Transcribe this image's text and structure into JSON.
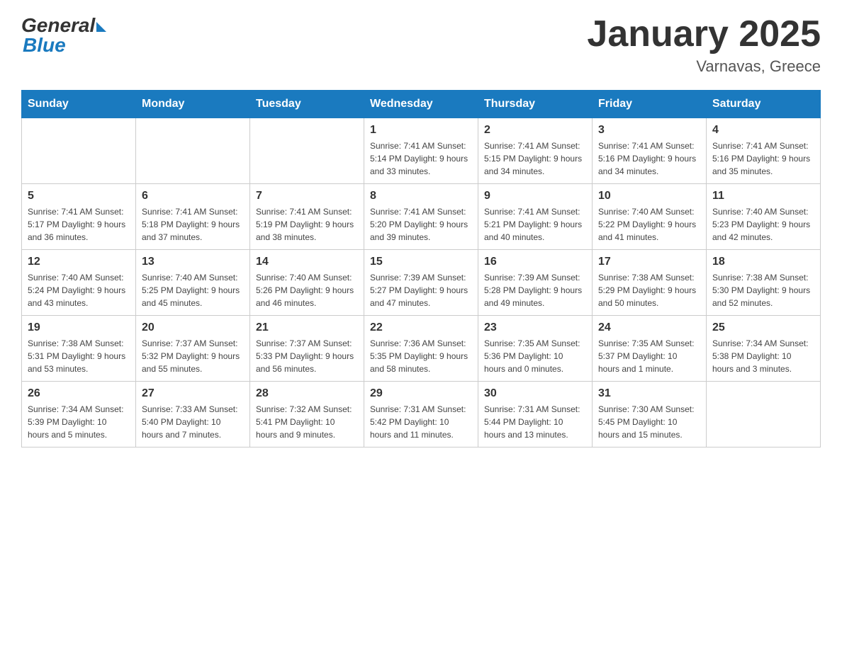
{
  "header": {
    "logo": {
      "general": "General",
      "blue": "Blue"
    },
    "title": "January 2025",
    "subtitle": "Varnavas, Greece"
  },
  "calendar": {
    "weekdays": [
      "Sunday",
      "Monday",
      "Tuesday",
      "Wednesday",
      "Thursday",
      "Friday",
      "Saturday"
    ],
    "weeks": [
      [
        {
          "day": "",
          "info": ""
        },
        {
          "day": "",
          "info": ""
        },
        {
          "day": "",
          "info": ""
        },
        {
          "day": "1",
          "info": "Sunrise: 7:41 AM\nSunset: 5:14 PM\nDaylight: 9 hours\nand 33 minutes."
        },
        {
          "day": "2",
          "info": "Sunrise: 7:41 AM\nSunset: 5:15 PM\nDaylight: 9 hours\nand 34 minutes."
        },
        {
          "day": "3",
          "info": "Sunrise: 7:41 AM\nSunset: 5:16 PM\nDaylight: 9 hours\nand 34 minutes."
        },
        {
          "day": "4",
          "info": "Sunrise: 7:41 AM\nSunset: 5:16 PM\nDaylight: 9 hours\nand 35 minutes."
        }
      ],
      [
        {
          "day": "5",
          "info": "Sunrise: 7:41 AM\nSunset: 5:17 PM\nDaylight: 9 hours\nand 36 minutes."
        },
        {
          "day": "6",
          "info": "Sunrise: 7:41 AM\nSunset: 5:18 PM\nDaylight: 9 hours\nand 37 minutes."
        },
        {
          "day": "7",
          "info": "Sunrise: 7:41 AM\nSunset: 5:19 PM\nDaylight: 9 hours\nand 38 minutes."
        },
        {
          "day": "8",
          "info": "Sunrise: 7:41 AM\nSunset: 5:20 PM\nDaylight: 9 hours\nand 39 minutes."
        },
        {
          "day": "9",
          "info": "Sunrise: 7:41 AM\nSunset: 5:21 PM\nDaylight: 9 hours\nand 40 minutes."
        },
        {
          "day": "10",
          "info": "Sunrise: 7:40 AM\nSunset: 5:22 PM\nDaylight: 9 hours\nand 41 minutes."
        },
        {
          "day": "11",
          "info": "Sunrise: 7:40 AM\nSunset: 5:23 PM\nDaylight: 9 hours\nand 42 minutes."
        }
      ],
      [
        {
          "day": "12",
          "info": "Sunrise: 7:40 AM\nSunset: 5:24 PM\nDaylight: 9 hours\nand 43 minutes."
        },
        {
          "day": "13",
          "info": "Sunrise: 7:40 AM\nSunset: 5:25 PM\nDaylight: 9 hours\nand 45 minutes."
        },
        {
          "day": "14",
          "info": "Sunrise: 7:40 AM\nSunset: 5:26 PM\nDaylight: 9 hours\nand 46 minutes."
        },
        {
          "day": "15",
          "info": "Sunrise: 7:39 AM\nSunset: 5:27 PM\nDaylight: 9 hours\nand 47 minutes."
        },
        {
          "day": "16",
          "info": "Sunrise: 7:39 AM\nSunset: 5:28 PM\nDaylight: 9 hours\nand 49 minutes."
        },
        {
          "day": "17",
          "info": "Sunrise: 7:38 AM\nSunset: 5:29 PM\nDaylight: 9 hours\nand 50 minutes."
        },
        {
          "day": "18",
          "info": "Sunrise: 7:38 AM\nSunset: 5:30 PM\nDaylight: 9 hours\nand 52 minutes."
        }
      ],
      [
        {
          "day": "19",
          "info": "Sunrise: 7:38 AM\nSunset: 5:31 PM\nDaylight: 9 hours\nand 53 minutes."
        },
        {
          "day": "20",
          "info": "Sunrise: 7:37 AM\nSunset: 5:32 PM\nDaylight: 9 hours\nand 55 minutes."
        },
        {
          "day": "21",
          "info": "Sunrise: 7:37 AM\nSunset: 5:33 PM\nDaylight: 9 hours\nand 56 minutes."
        },
        {
          "day": "22",
          "info": "Sunrise: 7:36 AM\nSunset: 5:35 PM\nDaylight: 9 hours\nand 58 minutes."
        },
        {
          "day": "23",
          "info": "Sunrise: 7:35 AM\nSunset: 5:36 PM\nDaylight: 10 hours\nand 0 minutes."
        },
        {
          "day": "24",
          "info": "Sunrise: 7:35 AM\nSunset: 5:37 PM\nDaylight: 10 hours\nand 1 minute."
        },
        {
          "day": "25",
          "info": "Sunrise: 7:34 AM\nSunset: 5:38 PM\nDaylight: 10 hours\nand 3 minutes."
        }
      ],
      [
        {
          "day": "26",
          "info": "Sunrise: 7:34 AM\nSunset: 5:39 PM\nDaylight: 10 hours\nand 5 minutes."
        },
        {
          "day": "27",
          "info": "Sunrise: 7:33 AM\nSunset: 5:40 PM\nDaylight: 10 hours\nand 7 minutes."
        },
        {
          "day": "28",
          "info": "Sunrise: 7:32 AM\nSunset: 5:41 PM\nDaylight: 10 hours\nand 9 minutes."
        },
        {
          "day": "29",
          "info": "Sunrise: 7:31 AM\nSunset: 5:42 PM\nDaylight: 10 hours\nand 11 minutes."
        },
        {
          "day": "30",
          "info": "Sunrise: 7:31 AM\nSunset: 5:44 PM\nDaylight: 10 hours\nand 13 minutes."
        },
        {
          "day": "31",
          "info": "Sunrise: 7:30 AM\nSunset: 5:45 PM\nDaylight: 10 hours\nand 15 minutes."
        },
        {
          "day": "",
          "info": ""
        }
      ]
    ]
  }
}
